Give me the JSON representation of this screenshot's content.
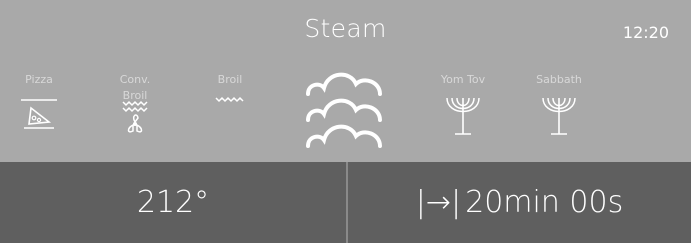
{
  "header": {
    "title": "Steam",
    "clock": "12:20"
  },
  "modes": [
    {
      "label": "Pizza",
      "icon": "pizza-icon"
    },
    {
      "label": "Conv. Broil",
      "icon": "conv-broil-icon"
    },
    {
      "label": "Broil",
      "icon": "broil-icon"
    },
    {
      "label": "Yom Tov",
      "icon": "menorah-icon"
    },
    {
      "label": "Sabbath",
      "icon": "menorah-icon"
    }
  ],
  "selected_mode_icon": "steam-icon",
  "bottom": {
    "temperature": "212°",
    "timer_icon": "|→|",
    "timer": "20min 00s"
  },
  "colors": {
    "top_bg": "#a9a9a9",
    "bottom_bg": "#5f5f5f",
    "text": "#ffffff"
  }
}
